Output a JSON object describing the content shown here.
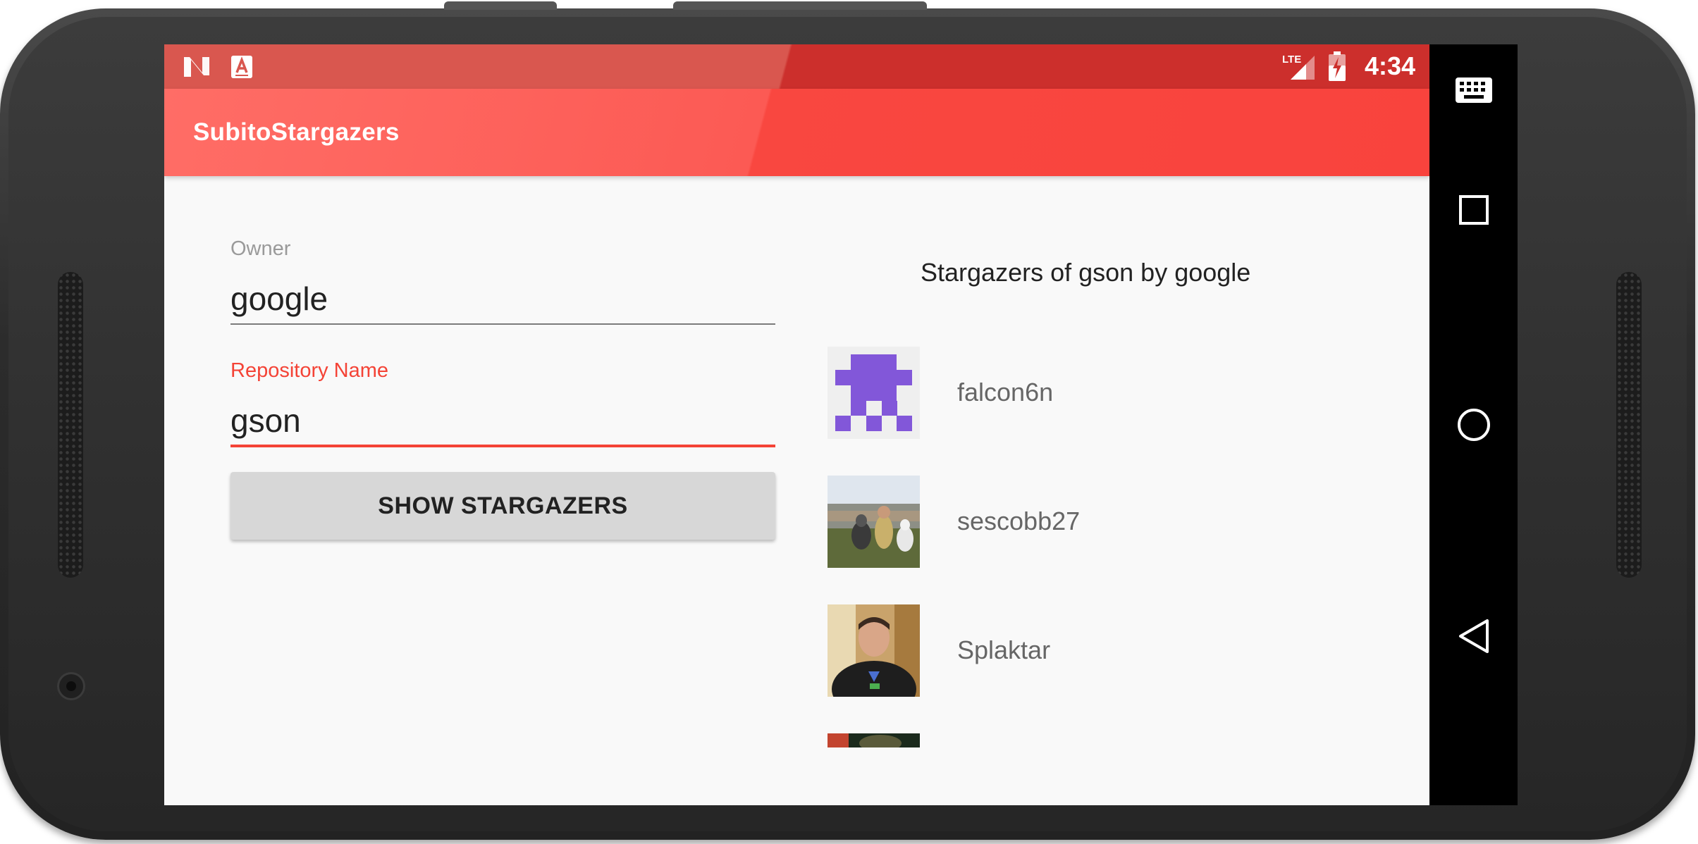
{
  "status_bar": {
    "left_icons": [
      "n-logo-icon",
      "font-a-icon"
    ],
    "right_icons": [
      "lte-signal-icon",
      "battery-icon"
    ],
    "network_label": "LTE",
    "time": "4:34"
  },
  "app_bar": {
    "title": "SubitoStargazers"
  },
  "form": {
    "owner_label": "Owner",
    "owner_value": "google",
    "repo_label": "Repository Name",
    "repo_value": "gson",
    "button_label": "SHOW STARGAZERS"
  },
  "stargazers": {
    "title": "Stargazers of gson by google",
    "items": [
      {
        "name": "falcon6n",
        "avatar": "identicon-avatar"
      },
      {
        "name": "sescobb27",
        "avatar": "photo-avatar-dogs"
      },
      {
        "name": "Splaktar",
        "avatar": "photo-avatar-man"
      },
      {
        "name": "",
        "avatar": "photo-avatar-partial"
      }
    ]
  },
  "nav_bar": {
    "buttons": [
      "keyboard-icon",
      "recents-icon",
      "home-icon",
      "back-icon"
    ]
  },
  "colors": {
    "accent": "#f44336",
    "app_bar": "#f94740",
    "status_bar": "#cc2f2c",
    "button_bg": "#d7d7d7",
    "identicon": "#8257d9"
  }
}
